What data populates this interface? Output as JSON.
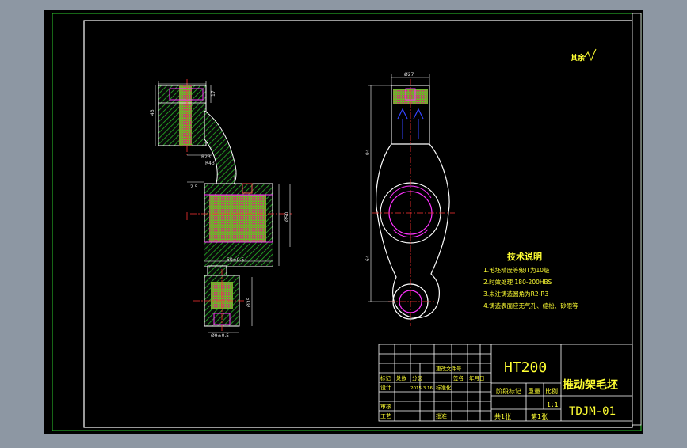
{
  "drawing": {
    "corner_mark": "其余",
    "part_a": {
      "dim_top": "17",
      "dim_left": "43",
      "dim_r1": "R23",
      "dim_r2": "R43",
      "dim_dia": "Ø50",
      "dim_width": "50±0.5",
      "dim_step": "2.5",
      "dim_lower": "Ø35",
      "dim_bottom": "Ø9±0.5"
    },
    "part_b": {
      "dim_top": "Ø27",
      "dim_upper": "94",
      "dim_lower": "64"
    },
    "notes": {
      "title": "技术说明",
      "items": [
        "1.毛坯精度等级IT为10级",
        "2.时效处理 180-200HBS",
        "3.未注铸造圆角为R2-R3",
        "4.铸造表面应无气孔、缩松、砂眼等"
      ]
    },
    "title_block": {
      "material": "HT200",
      "part_name": "推动架毛坯",
      "drawing_no": "TDJM-01",
      "scale": "1:1",
      "sheet_total": "共1张",
      "sheet_no": "第1张",
      "stage_mark": "阶段标记",
      "weight": "重量",
      "scale_label": "比例",
      "rev_headers": [
        "标记",
        "处数",
        "分区",
        "更改文件号",
        "签名",
        "年月日"
      ],
      "design": "设计",
      "design_date": "2015.3.16",
      "standardize": "标准化",
      "review": "审核",
      "process": "工艺",
      "approve": "批准"
    }
  }
}
